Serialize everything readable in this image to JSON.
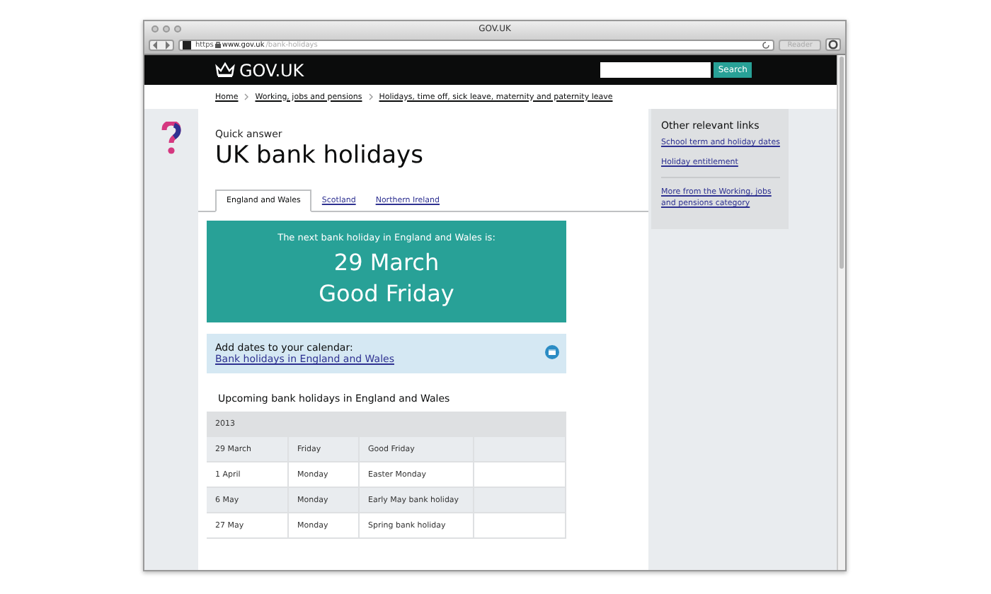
{
  "window": {
    "title": "GOV.UK"
  },
  "address_bar": {
    "scheme": "https",
    "host": "www.gov.uk",
    "path": "/bank-holidays",
    "reader_button": "Reader"
  },
  "header": {
    "logo": "GOV.UK",
    "search_button": "Search"
  },
  "breadcrumbs": [
    "Home",
    "Working, jobs and pensions",
    "Holidays, time off, sick leave, maternity and paternity leave"
  ],
  "page": {
    "kicker": "Quick answer",
    "title": "UK bank holidays"
  },
  "tabs": [
    {
      "label": "England and Wales",
      "selected": true
    },
    {
      "label": "Scotland",
      "selected": false
    },
    {
      "label": "Northern Ireland",
      "selected": false
    }
  ],
  "next_holiday": {
    "intro": "The next bank holiday in England and Wales is:",
    "date": "29 March",
    "name": "Good Friday"
  },
  "calendar": {
    "label": "Add dates to your calendar:",
    "link": "Bank holidays in England and Wales"
  },
  "table": {
    "caption": "Upcoming bank holidays in England and Wales",
    "year": "2013",
    "rows": [
      {
        "cells": [
          "29 March",
          "Friday",
          "Good Friday"
        ]
      },
      {
        "cells": [
          "1 April",
          "Monday",
          "Easter Monday"
        ]
      },
      {
        "cells": [
          "6 May",
          "Monday",
          "Early May bank holiday"
        ]
      },
      {
        "cells": [
          "27 May",
          "Monday",
          "Spring bank holiday"
        ]
      }
    ]
  },
  "sidebar": {
    "heading": "Other relevant links",
    "links": [
      "School term and holiday dates",
      "Holiday entitlement"
    ],
    "more_link": "More from the Working, jobs and pensions category"
  }
}
